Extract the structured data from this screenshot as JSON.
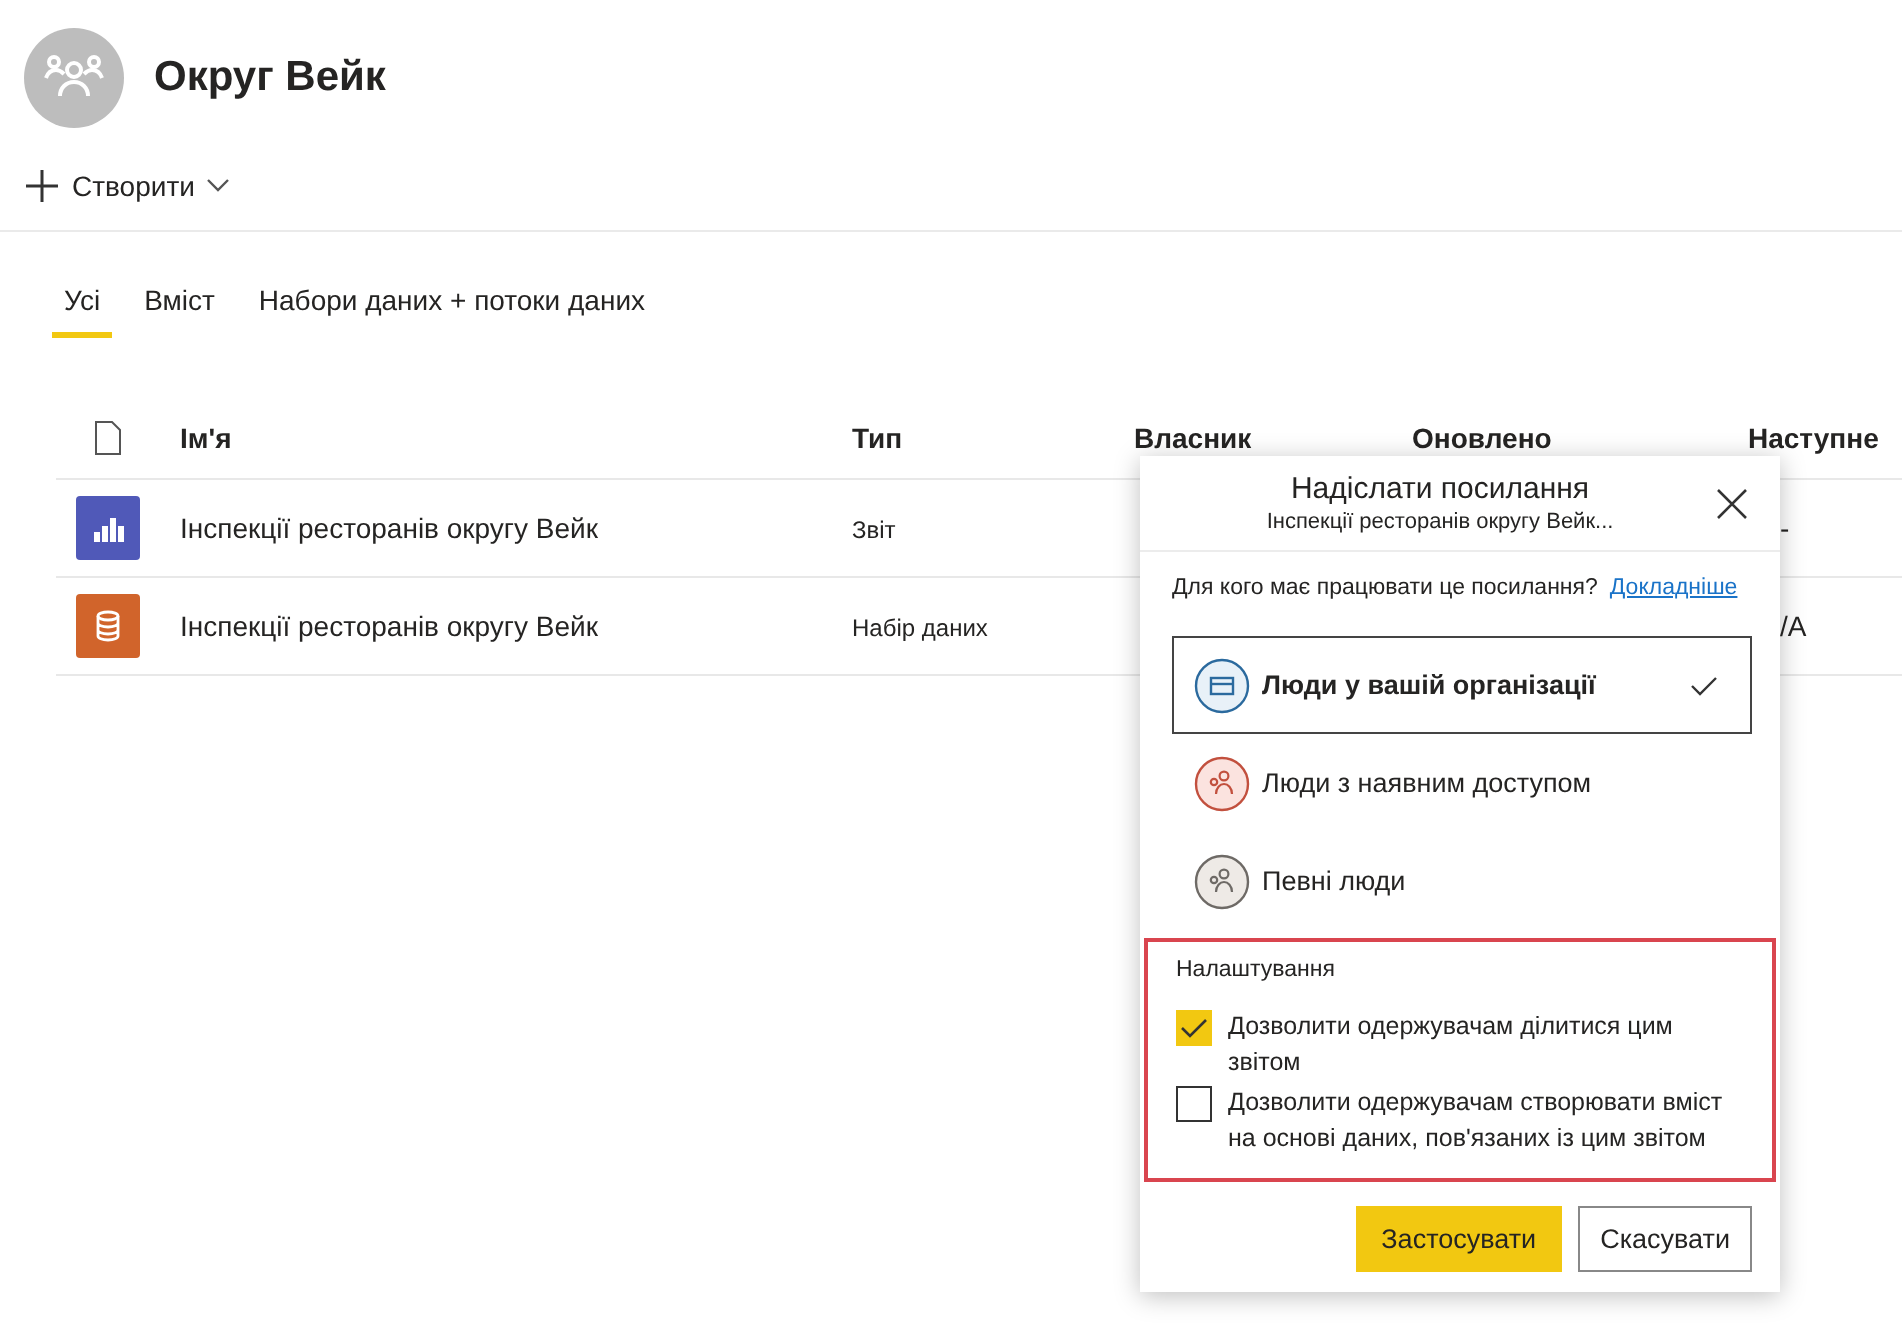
{
  "workspace": {
    "title": "Округ Вейк"
  },
  "create_button": {
    "label": "Створити"
  },
  "tabs": [
    {
      "label": "Усі",
      "selected": true
    },
    {
      "label": "Вміст",
      "selected": false
    },
    {
      "label": "Набори даних + потоки даних",
      "selected": false
    }
  ],
  "table": {
    "columns": [
      "Ім'я",
      "Тип",
      "Власник",
      "Оновлено",
      "Наступне"
    ],
    "rows": [
      {
        "kind": "report",
        "name": "Інспекції ресторанів округу Вейк",
        "type": "Звіт",
        "column_5": "-"
      },
      {
        "kind": "dataset",
        "name": "Інспекції ресторанів округу Вейк",
        "type": "Набір даних",
        "column_5": "/A"
      }
    ]
  },
  "dialog": {
    "title": "Надіслати посилання",
    "subtitle": "Інспекції ресторанів округу Вейк...",
    "question": "Для кого має працювати це посилання?",
    "learn_more": "Докладніше",
    "options": [
      {
        "kind": "organization",
        "label": "Люди у вашій організації",
        "selected": true
      },
      {
        "kind": "existing",
        "label": "Люди з наявним доступом",
        "selected": false
      },
      {
        "kind": "specific",
        "label": "Певні люди",
        "selected": false
      }
    ],
    "settings_title": "Налаштування",
    "settings": [
      {
        "label": "Дозволити одержувачам ділитися цим звітом",
        "checked": true
      },
      {
        "label": "Дозволити одержувачам створювати вміст на основі даних, пов'язаних із цим звітом",
        "checked": false
      }
    ],
    "buttons": [
      {
        "kind": "primary",
        "label": "Застосувати"
      },
      {
        "kind": "secondary",
        "label": "Скасувати"
      }
    ]
  }
}
